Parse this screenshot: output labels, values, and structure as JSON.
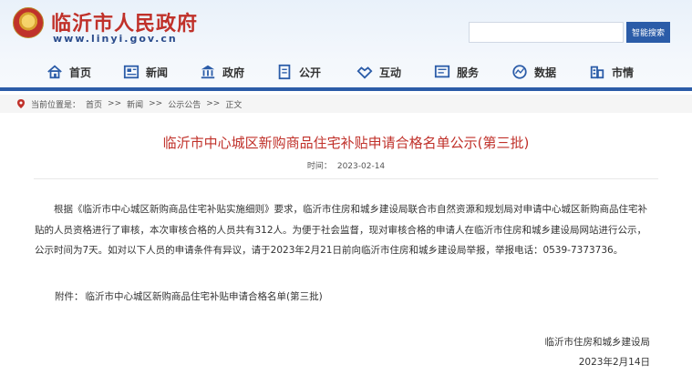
{
  "header": {
    "title": "临沂市人民政府",
    "url": "www.linyi.gov.cn",
    "search_placeholder": "",
    "search_button": "智能搜索"
  },
  "nav": {
    "items": [
      {
        "label": "首页",
        "icon": "home-icon"
      },
      {
        "label": "新闻",
        "icon": "newspaper-icon"
      },
      {
        "label": "政府",
        "icon": "government-building-icon"
      },
      {
        "label": "公开",
        "icon": "document-icon"
      },
      {
        "label": "互动",
        "icon": "handshake-icon"
      },
      {
        "label": "服务",
        "icon": "service-window-icon"
      },
      {
        "label": "数据",
        "icon": "globe-data-icon"
      },
      {
        "label": "市情",
        "icon": "city-building-icon"
      }
    ],
    "accent_color": "#2b5ca8"
  },
  "breadcrumb": {
    "label": "当前位置是：",
    "items": [
      "首页",
      "新闻",
      "公示公告",
      "正文"
    ],
    "separator": ">>"
  },
  "article": {
    "title": "临沂市中心城区新购商品住宅补贴申请合格名单公示(第三批)",
    "time_label": "时间：",
    "time": "2023-02-14",
    "body": "根据《临沂市中心城区新购商品住宅补贴实施细则》要求，临沂市住房和城乡建设局联合市自然资源和规划局对申请中心城区新购商品住宅补贴的人员资格进行了审核，本次审核合格的人员共有312人。为便于社会监督，现对审核合格的申请人在临沂市住房和城乡建设局网站进行公示，公示时间为7天。如对以下人员的申请条件有异议，请于2023年2月21日前向临沂市住房和城乡建设局举报，举报电话：0539-7373736。",
    "attachment_label": "附件：",
    "attachment": "临沂市中心城区新购商品住宅补贴申请合格名单(第三批)",
    "signature_org": "临沂市住房和城乡建设局",
    "signature_date": "2023年2月14日",
    "title_color": "#c0312a"
  }
}
